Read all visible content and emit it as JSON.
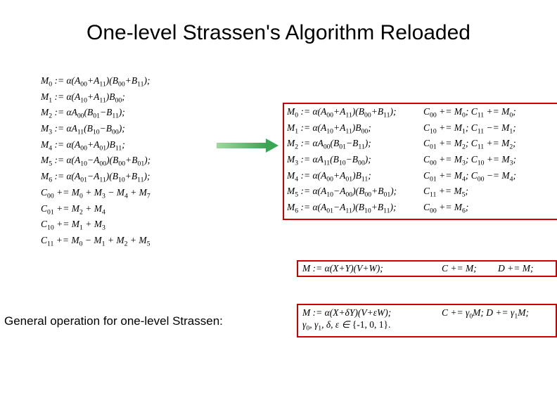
{
  "title": "One-level Strassen's Algorithm Reloaded",
  "left": {
    "m0": "M₀ := α(A₀₀+A₁₁)(B₀₀+B₁₁);",
    "m1": "M₁ := α(A₁₀+A₁₁)B₀₀;",
    "m2": "M₂ := αA₀₀(B₀₁−B₁₁);",
    "m3": "M₃ := αA₁₁(B₁₀−B₀₀);",
    "m4": "M₄ := α(A₀₀+A₀₁)B₁₁;",
    "m5": "M₅ := α(A₁₀−A₀₀)(B₀₀+B₀₁);",
    "m6": "M₆ := α(A₀₁−A₁₁)(B₁₀+B₁₁);",
    "c00": "C₀₀ += M₀ + M₃ − M₄ + M₇",
    "c01": "C₀₁ += M₂ + M₄",
    "c10": "C₁₀ += M₁ + M₃",
    "c11": "C₁₁ += M₀ − M₁ + M₂ + M₅"
  },
  "right": {
    "col1": {
      "m0": "M₀ := α(A₀₀+A₁₁)(B₀₀+B₁₁);",
      "m1": "M₁ := α(A₁₀+A₁₁)B₀₀;",
      "m2": "M₂ := αA₀₀(B₀₁−B₁₁);",
      "m3": "M₃ := αA₁₁(B₁₀−B₀₀);",
      "m4": "M₄ := α(A₀₀+A₀₁)B₁₁;",
      "m5": "M₅ := α(A₁₀−A₀₀)(B₀₀+B₀₁);",
      "m6": "M₆ := α(A₀₁−A₁₁)(B₁₀+B₁₁);"
    },
    "col2": {
      "r0": "C₀₀ += M₀; C₁₁ += M₀;",
      "r1": "C₁₀ += M₁; C₁₁ −= M₁;",
      "r2": "C₀₁ += M₂; C₁₁ += M₂;",
      "r3": "C₀₀ += M₃; C₁₀ += M₃;",
      "r4": "C₀₁ += M₄; C₀₀ −= M₄;",
      "r5": "C₁₁ += M₅;",
      "r6": "C₀₀ += M₆;"
    }
  },
  "box2": {
    "c1": "M := α(X+Y)(V+W);",
    "c2": "C += M;",
    "c3": "D += M;"
  },
  "box3": {
    "c1a": "M := α(X+δY)(V+εW);",
    "c1b": "γ₀, γ₁, δ, ε ∈ {-1, 0, 1}.",
    "c2": "C += γ₀M; D += γ₁M;"
  },
  "general_label": "General operation for one-level Strassen:"
}
